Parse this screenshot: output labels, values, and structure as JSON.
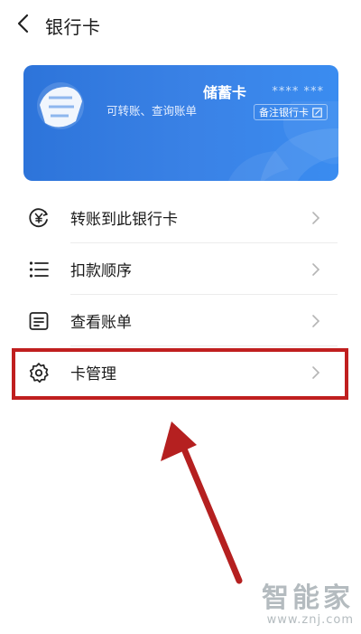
{
  "header": {
    "title": "银行卡"
  },
  "card": {
    "type": "储蓄卡",
    "description": "可转账、查询账单",
    "number_masked": "**** ***",
    "note_button": "备注银行卡"
  },
  "menu": {
    "items": [
      {
        "label": "转账到此银行卡",
        "icon": "yen-circle-icon"
      },
      {
        "label": "扣款顺序",
        "icon": "list-icon"
      },
      {
        "label": "查看账单",
        "icon": "bill-icon"
      },
      {
        "label": "卡管理",
        "icon": "gear-icon"
      }
    ]
  },
  "watermark": {
    "main": "智能家",
    "url": "www.znj.com"
  },
  "colors": {
    "card_blue": "#2d74da",
    "highlight_red": "#c01f1f"
  }
}
